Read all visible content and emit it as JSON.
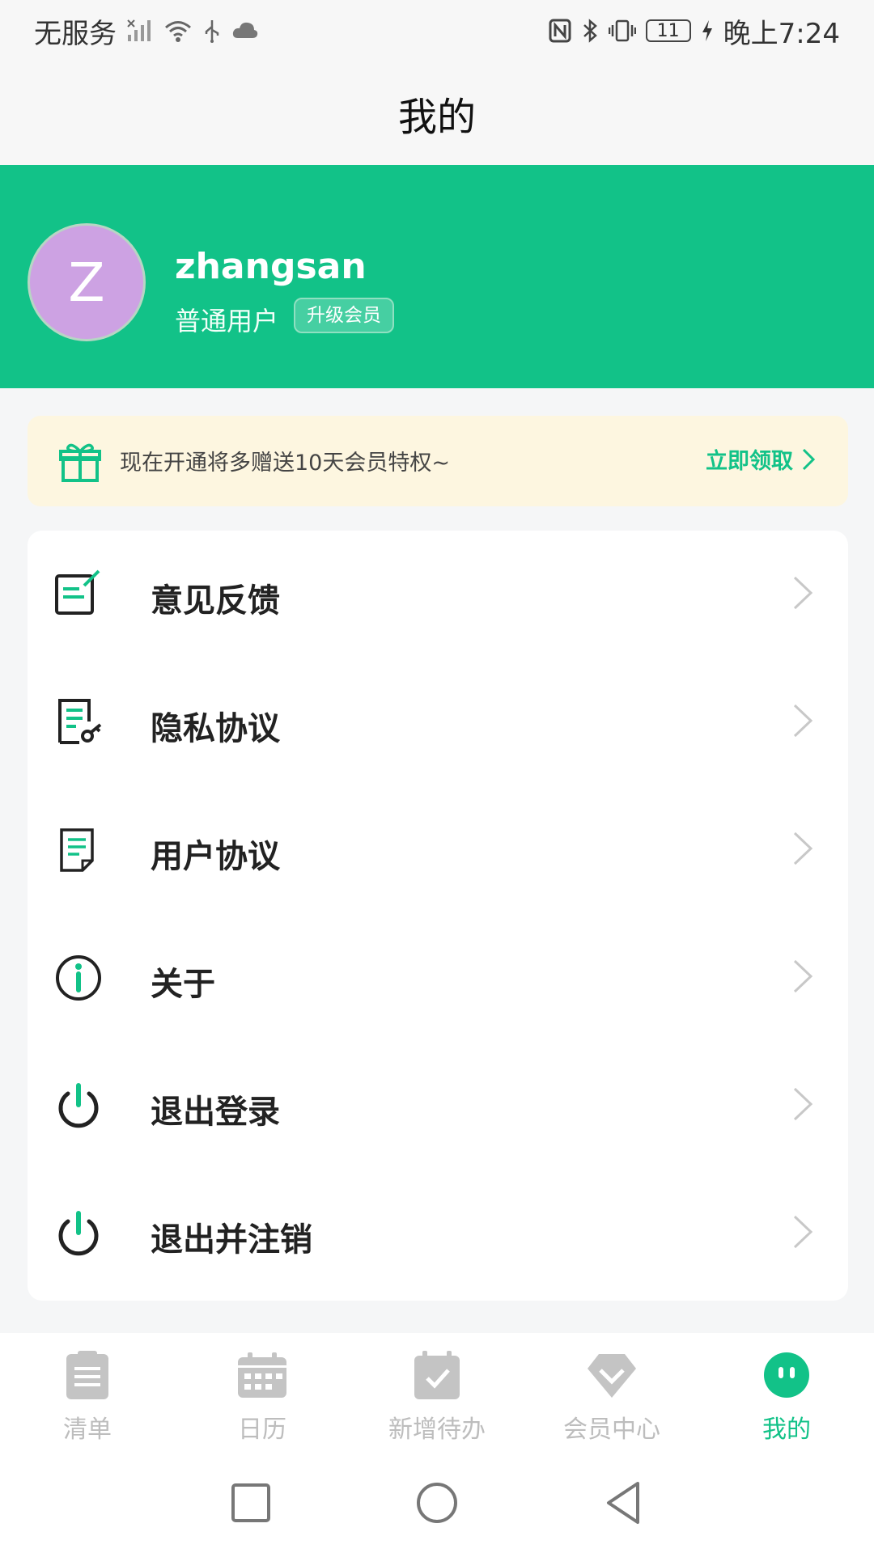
{
  "statusbar": {
    "carrier": "无服务",
    "battery": "11",
    "time": "晚上7:24",
    "icons": [
      "signal-off-icon",
      "wifi-icon",
      "usb-icon",
      "cloud-icon",
      "nfc-icon",
      "bluetooth-icon",
      "vibrate-icon",
      "battery-icon",
      "charging-icon"
    ]
  },
  "page": {
    "title": "我的"
  },
  "profile": {
    "avatar_letter": "Z",
    "username": "zhangsan",
    "user_type": "普通用户",
    "upgrade_label": "升级会员",
    "colors": {
      "header_bg": "#12c288",
      "avatar_bg": "#cda2e3"
    }
  },
  "promo": {
    "text": "现在开通将多赠送10天会员特权~",
    "action": "立即领取",
    "icon": "gift-icon"
  },
  "menu": {
    "items": [
      {
        "label": "意见反馈",
        "icon": "feedback-edit-icon"
      },
      {
        "label": "隐私协议",
        "icon": "privacy-doc-key-icon"
      },
      {
        "label": "用户协议",
        "icon": "user-agreement-doc-icon"
      },
      {
        "label": "关于",
        "icon": "info-icon"
      },
      {
        "label": "退出登录",
        "icon": "power-icon"
      },
      {
        "label": "退出并注销",
        "icon": "power-icon"
      }
    ]
  },
  "tabs": [
    {
      "label": "清单",
      "icon": "clipboard-list-icon",
      "active": false
    },
    {
      "label": "日历",
      "icon": "calendar-icon",
      "active": false
    },
    {
      "label": "新增待办",
      "icon": "calendar-check-icon",
      "active": false
    },
    {
      "label": "会员中心",
      "icon": "diamond-icon",
      "active": false
    },
    {
      "label": "我的",
      "icon": "smiley-face-icon",
      "active": true
    }
  ],
  "accent_color": "#12c288"
}
